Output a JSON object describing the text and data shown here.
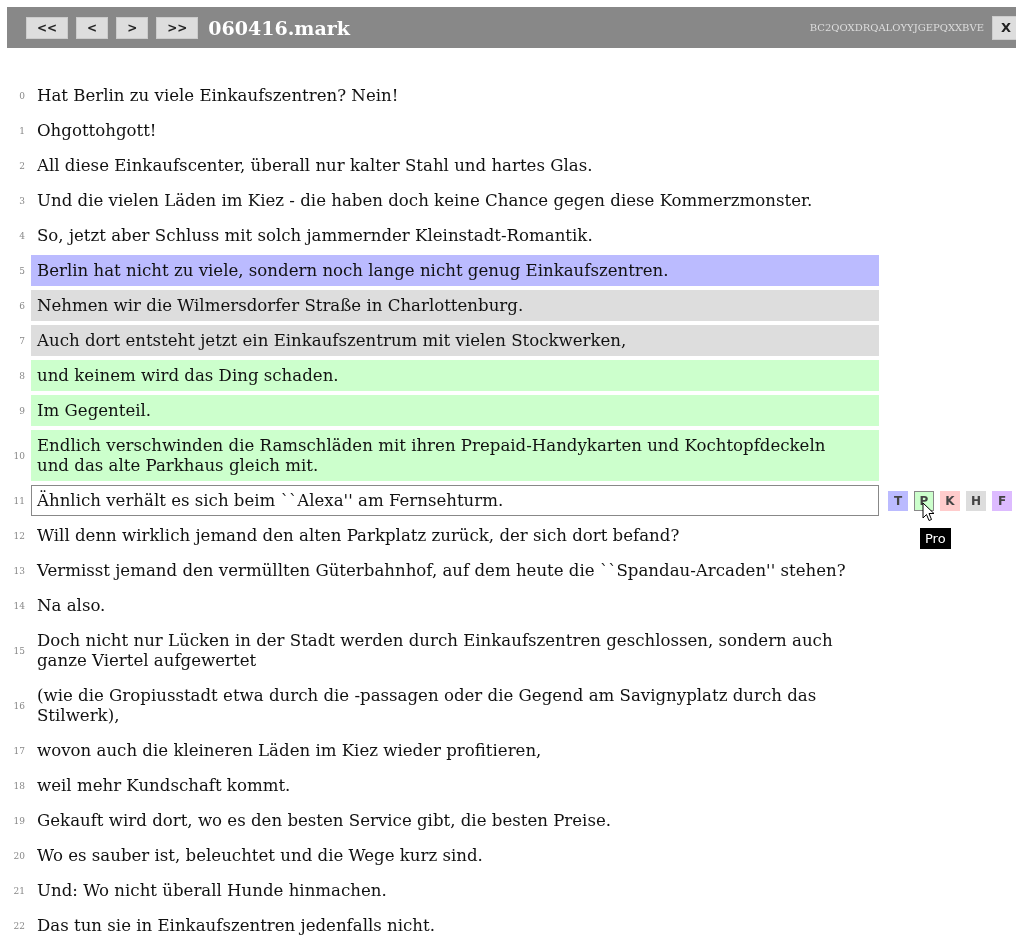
{
  "toolbar": {
    "nav_buttons": [
      "<<",
      "<",
      ">",
      ">>"
    ],
    "title": "060416.mark",
    "code": "BC2QOXDRQALOYYJGEPQXXBVE",
    "close": "X"
  },
  "labels": [
    {
      "letter": "T",
      "color": "#bbbbff",
      "hovered": false
    },
    {
      "letter": "P",
      "color": "#ccffcc",
      "hovered": true
    },
    {
      "letter": "K",
      "color": "#ffcccc",
      "hovered": false
    },
    {
      "letter": "H",
      "color": "#dddddd",
      "hovered": false
    },
    {
      "letter": "F",
      "color": "#ddbbff",
      "hovered": false
    }
  ],
  "tooltip": "Pro",
  "sentences": [
    {
      "number": "0",
      "text": "Hat Berlin zu viele Einkaufszentren? Nein!",
      "selected": false
    },
    {
      "number": "1",
      "text": "Ohgottohgott!",
      "selected": false
    },
    {
      "number": "2",
      "text": "All diese Einkaufscenter, überall nur kalter Stahl und hartes Glas.",
      "selected": false
    },
    {
      "number": "3",
      "text": "Und die vielen Läden im Kiez - die haben doch keine Chance gegen diese Kommerzmonster.",
      "selected": false
    },
    {
      "number": "4",
      "text": "So, jetzt aber Schluss mit solch jammernder Kleinstadt-Romantik.",
      "selected": false
    },
    {
      "number": "5",
      "text": "Berlin hat nicht zu viele, sondern noch lange nicht genug Einkaufszentren.",
      "selected": false,
      "color": "#bbbbff"
    },
    {
      "number": "6",
      "text": "Nehmen wir die Wilmersdorfer Straße in Charlottenburg.",
      "selected": false,
      "color": "#dddddd"
    },
    {
      "number": "7",
      "text": "Auch dort entsteht jetzt ein Einkaufszentrum mit vielen Stockwerken,",
      "selected": false,
      "color": "#dddddd"
    },
    {
      "number": "8",
      "text": "und keinem wird das Ding schaden.",
      "selected": false,
      "color": "#ccffcc"
    },
    {
      "number": "9",
      "text": "Im Gegenteil.",
      "selected": false,
      "color": "#ccffcc"
    },
    {
      "number": "10",
      "text": "Endlich verschwinden die Ramschläden mit ihren Prepaid-Handykarten und Kochtopfdeckeln und das alte Parkhaus gleich mit.",
      "selected": false,
      "color": "#ccffcc"
    },
    {
      "number": "11",
      "text": "Ähnlich verhält es sich beim ``Alexa'' am Fernsehturm.",
      "selected": true
    },
    {
      "number": "12",
      "text": "Will denn wirklich jemand den alten Parkplatz zurück, der sich dort befand?",
      "selected": false
    },
    {
      "number": "13",
      "text": "Vermisst jemand den vermüllten Güterbahnhof, auf dem heute die ``Spandau-Arcaden'' stehen?",
      "selected": false
    },
    {
      "number": "14",
      "text": "Na also.",
      "selected": false
    },
    {
      "number": "15",
      "text": "Doch nicht nur Lücken in der Stadt werden durch Einkaufszentren geschlossen, sondern auch ganze Viertel aufgewertet",
      "selected": false
    },
    {
      "number": "16",
      "text": "(wie die Gropiusstadt etwa durch die -passagen oder die Gegend am Savignyplatz durch das Stilwerk),",
      "selected": false
    },
    {
      "number": "17",
      "text": "wovon auch die kleineren Läden im Kiez wieder profitieren,",
      "selected": false
    },
    {
      "number": "18",
      "text": "weil mehr Kundschaft kommt.",
      "selected": false
    },
    {
      "number": "19",
      "text": "Gekauft wird dort, wo es den besten Service gibt, die besten Preise.",
      "selected": false
    },
    {
      "number": "20",
      "text": "Wo es sauber ist, beleuchtet und die Wege kurz sind.",
      "selected": false
    },
    {
      "number": "21",
      "text": "Und: Wo nicht überall Hunde hinmachen.",
      "selected": false
    },
    {
      "number": "22",
      "text": "Das tun sie in Einkaufszentren jedenfalls nicht.",
      "selected": false
    }
  ]
}
